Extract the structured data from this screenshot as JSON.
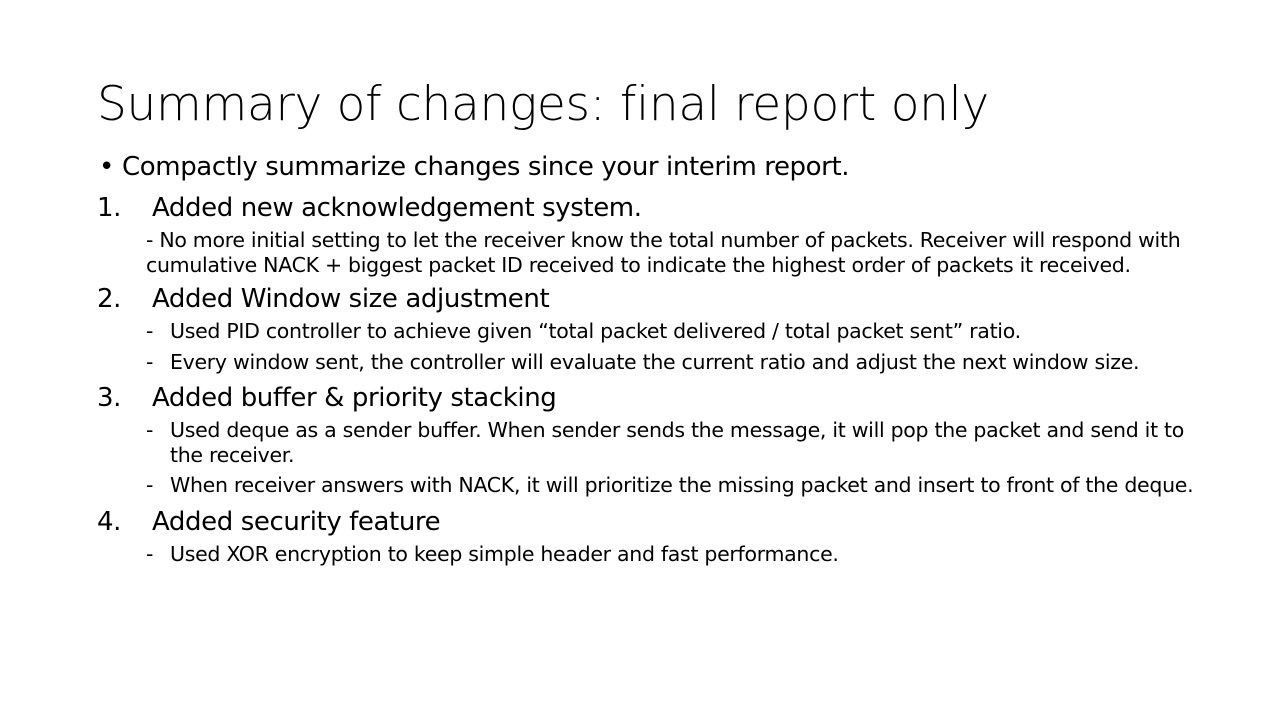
{
  "slide": {
    "title": "Summary of changes: final report only",
    "intro_bullet": {
      "marker": "•",
      "text": "Compactly summarize changes since your interim report."
    },
    "sections": [
      {
        "number": "1.",
        "heading": "Added new acknowledgement system.",
        "note": "- No more initial setting to let the receiver know the total number of packets. Receiver will respond with cumulative NACK + biggest packet ID received to indicate the highest order of packets it received."
      },
      {
        "number": "2.",
        "heading": "Added Window size adjustment",
        "items": [
          "Used PID controller to achieve given “total packet delivered / total packet sent” ratio.",
          "Every window sent, the controller will evaluate the current ratio and adjust the next window size."
        ]
      },
      {
        "number": "3.",
        "heading": "Added buffer & priority stacking",
        "items": [
          "Used deque as a sender buffer. When sender sends the message, it will pop the packet and send it to the receiver.",
          "When receiver answers with NACK, it will prioritize the missing packet and insert to front of the deque."
        ]
      },
      {
        "number": "4.",
        "heading": "Added security feature",
        "items": [
          "Used XOR encryption to keep simple header and fast performance."
        ]
      }
    ],
    "dash_marker": "-"
  }
}
